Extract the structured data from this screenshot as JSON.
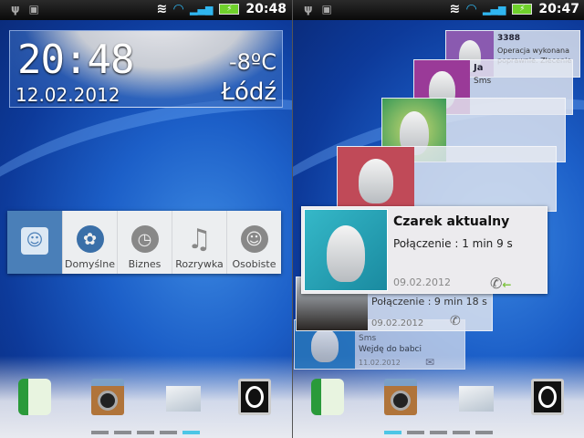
{
  "left_screen": {
    "status": {
      "time": "20:48"
    },
    "clock_widget": {
      "time": "20:48",
      "date": "12.02.2012",
      "temperature": "-8ºC",
      "city": "Łódź"
    },
    "app_row": [
      {
        "label": "",
        "icon": "timescape-icon"
      },
      {
        "label": "Domyślne",
        "icon": "gear-icon"
      },
      {
        "label": "Biznes",
        "icon": "clock-icon"
      },
      {
        "label": "Rozrywka",
        "icon": "music-note-icon"
      },
      {
        "label": "Osobiste",
        "icon": "smiley-icon"
      }
    ],
    "dock": [
      "phone-icon",
      "camera-icon",
      "mail-icon",
      "media-icon"
    ],
    "active_page": 5
  },
  "right_screen": {
    "status": {
      "time": "20:47"
    },
    "cards": [
      {
        "name": "3388",
        "text": "Operacja wykonana poprawnie. Zlecenie dol..."
      },
      {
        "name": "Ja",
        "text": "Sms"
      },
      {
        "name": "",
        "text": ""
      },
      {
        "name": "",
        "text": ""
      },
      {
        "name": "Czarek aktualny",
        "text": "Połączenie : 1 min 9 s",
        "date": "09.02.2012"
      },
      {
        "name": "",
        "text": "Połączenie : 9 min 18 s",
        "date": "09.02.2012"
      },
      {
        "name": "Sms",
        "text": "Wejdę do babci",
        "date": "11.02.2012"
      }
    ],
    "active_page": 1
  }
}
